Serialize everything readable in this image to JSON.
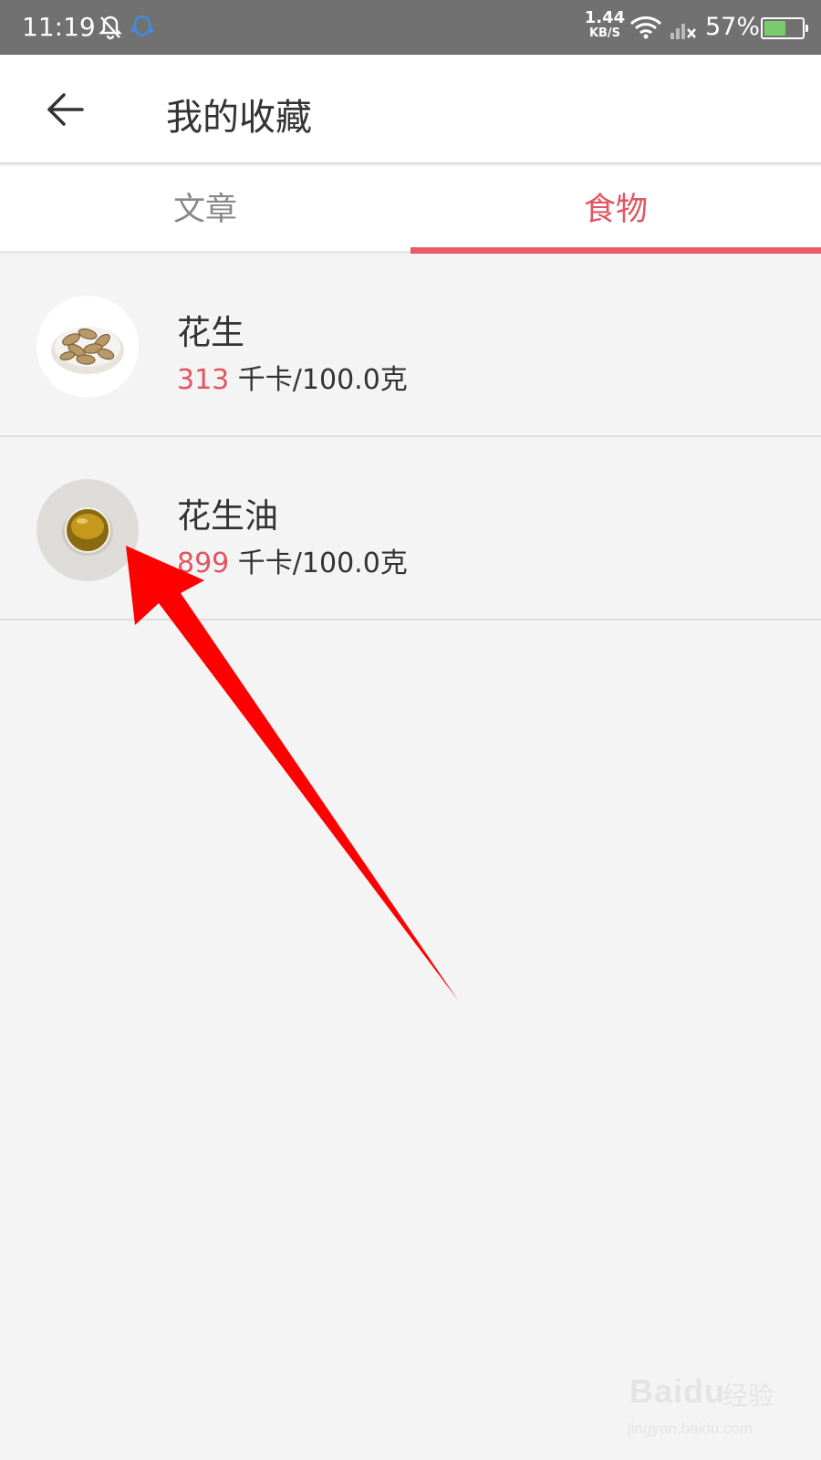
{
  "status_bar": {
    "time": "11:19",
    "net_speed_value": "1.44",
    "net_speed_unit": "KB/S",
    "battery_percent": "57%",
    "battery_level": 0.57,
    "icons": [
      "bell-off-icon",
      "qq-icon",
      "wifi-icon",
      "signal-off-icon",
      "battery-icon"
    ]
  },
  "header": {
    "title": "我的收藏",
    "back_icon": "back-arrow-icon"
  },
  "tabs": [
    {
      "label": "文章",
      "active": false
    },
    {
      "label": "食物",
      "active": true
    }
  ],
  "items": [
    {
      "name": "花生",
      "kcal": "313",
      "unit": " 千卡/100.0克",
      "thumb": "peanuts"
    },
    {
      "name": "花生油",
      "kcal": "899",
      "unit": " 千卡/100.0克",
      "thumb": "peanut-oil"
    }
  ],
  "watermark": {
    "brand": "Baidu",
    "cn": "经验",
    "url": "jingyan.baidu.com"
  },
  "colors": {
    "accent": "#e2555f",
    "status_bar": "#717171",
    "background": "#f4f4f4",
    "annotation_arrow": "#ff0000"
  }
}
